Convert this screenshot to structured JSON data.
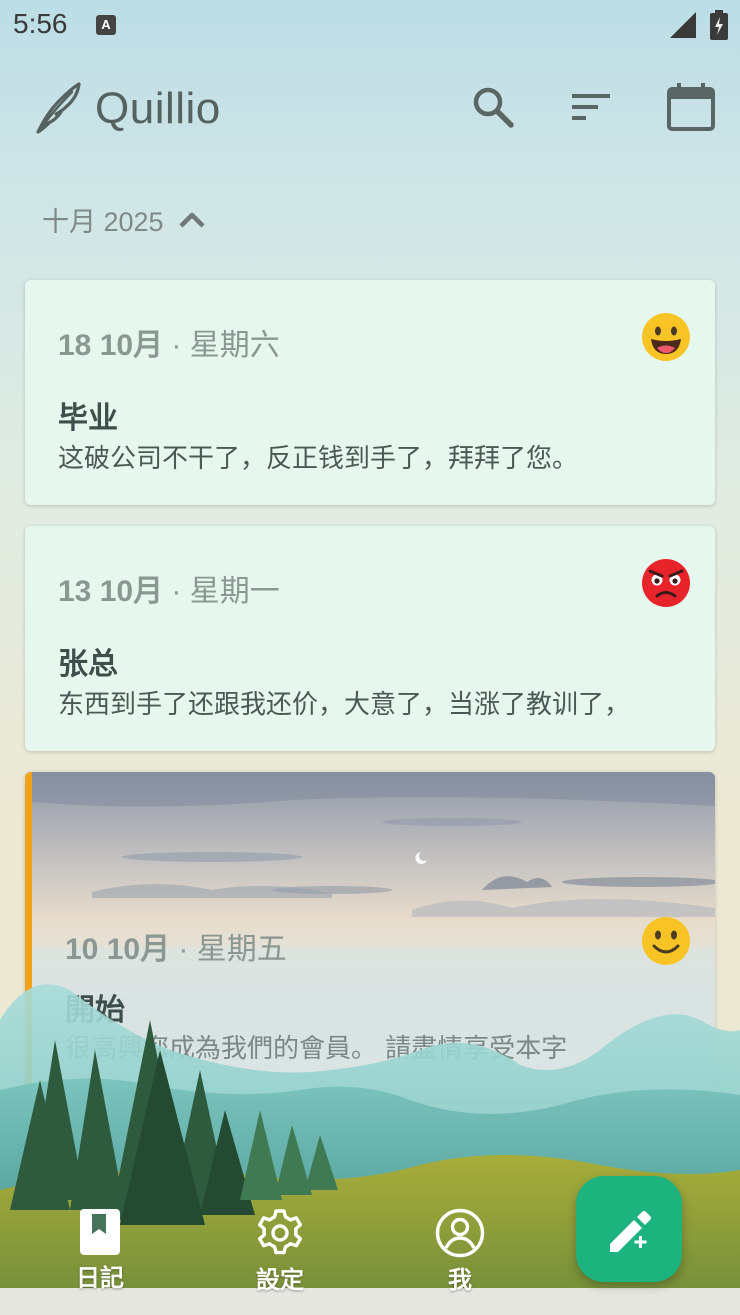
{
  "status_bar": {
    "time": "5:56",
    "notification_letter": "A"
  },
  "app_bar": {
    "title": "Quillio"
  },
  "month_header": {
    "label": "十月 2025"
  },
  "entries": [
    {
      "day": "18 10月",
      "weekday": "· 星期六",
      "title": "毕业",
      "body": "这破公司不干了，反正钱到手了，拜拜了您。",
      "mood": "grinning"
    },
    {
      "day": "13 10月",
      "weekday": "· 星期一",
      "title": "张总",
      "body": "东西到手了还跟我还价，大意了，当涨了教训了，",
      "mood": "angry"
    },
    {
      "day": "10 10月",
      "weekday": "· 星期五",
      "title": "開始",
      "body": "很高興您成為我們的會員。 請盡情享受本字",
      "mood": "smiling",
      "accent": "#f2a11a"
    }
  ],
  "bottom_nav": [
    {
      "label": "日記",
      "icon": "bookmark-icon"
    },
    {
      "label": "設定",
      "icon": "gear-icon"
    },
    {
      "label": "我",
      "icon": "account-icon"
    }
  ],
  "fab": {
    "icon": "edit-add-icon"
  },
  "colors": {
    "card_bg": "#e6f8ee",
    "fab": "#1db37f",
    "accent": "#f2a11a"
  }
}
